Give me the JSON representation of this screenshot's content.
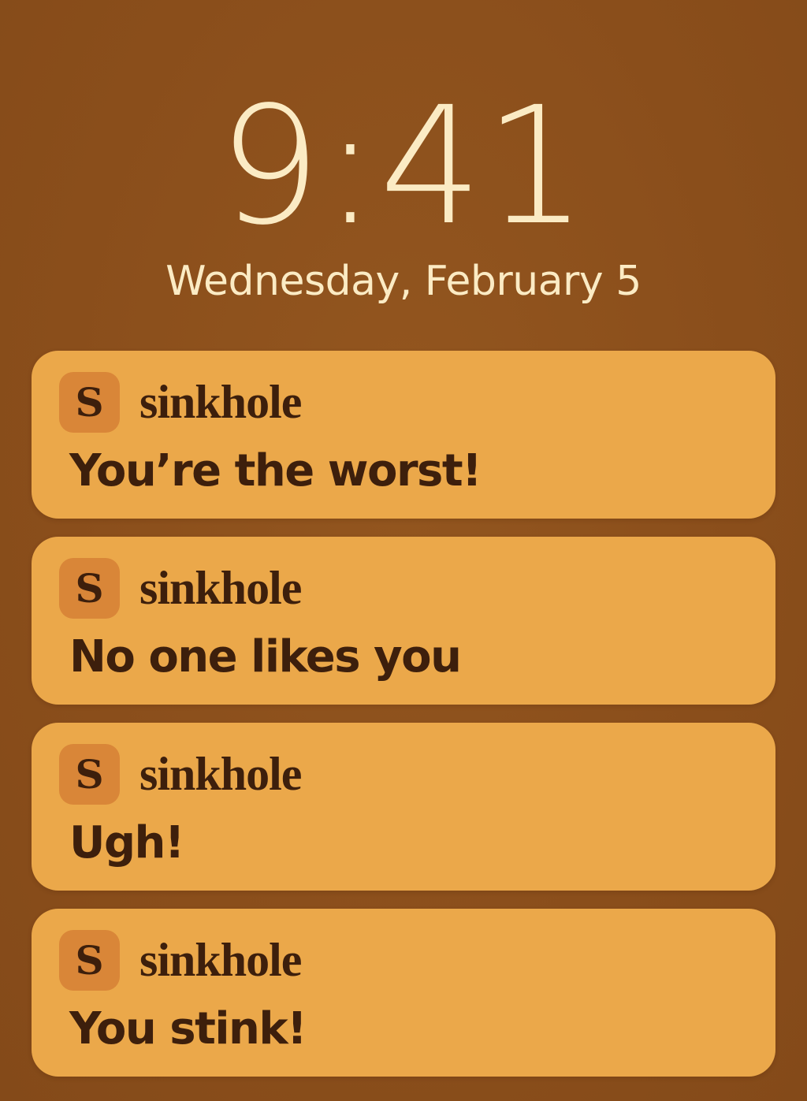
{
  "lockscreen": {
    "time": "9:41",
    "date": "Wednesday, February 5"
  },
  "notifications": [
    {
      "app_icon_letter": "S",
      "app_icon": "sinkhole-app-icon",
      "app_name": "sinkhole",
      "message": "You’re the worst!"
    },
    {
      "app_icon_letter": "S",
      "app_icon": "sinkhole-app-icon",
      "app_name": "sinkhole",
      "message": "No one likes you"
    },
    {
      "app_icon_letter": "S",
      "app_icon": "sinkhole-app-icon",
      "app_name": "sinkhole",
      "message": "Ugh!"
    },
    {
      "app_icon_letter": "S",
      "app_icon": "sinkhole-app-icon",
      "app_name": "sinkhole",
      "message": "You stink!"
    }
  ],
  "colors": {
    "background": "#8d501c",
    "clock_text": "#fbebc4",
    "notification_bg": "#eba84a",
    "icon_bg": "#d98638",
    "text_dark": "#3d1f0c"
  }
}
